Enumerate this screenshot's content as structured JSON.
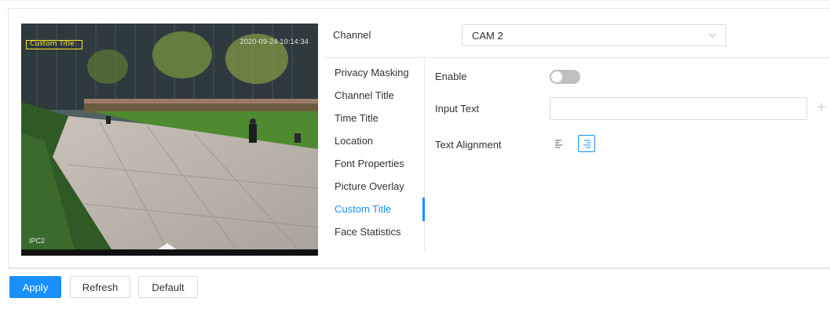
{
  "preview": {
    "osd_title": "Custom Title",
    "osd_time": "2020-09-24 10:14:34",
    "osd_channel": "IPC2"
  },
  "channel": {
    "label": "Channel",
    "value": "CAM 2"
  },
  "menu": {
    "items": [
      {
        "label": "Privacy Masking",
        "active": false
      },
      {
        "label": "Channel Title",
        "active": false
      },
      {
        "label": "Time Title",
        "active": false
      },
      {
        "label": "Location",
        "active": false
      },
      {
        "label": "Font Properties",
        "active": false
      },
      {
        "label": "Picture Overlay",
        "active": false
      },
      {
        "label": "Custom Title",
        "active": true
      },
      {
        "label": "Face Statistics",
        "active": false
      }
    ]
  },
  "settings": {
    "enable_label": "Enable",
    "enable_on": false,
    "input_text_label": "Input Text",
    "input_text_value": "",
    "text_alignment_label": "Text Alignment",
    "text_alignment_selected": "right"
  },
  "buttons": {
    "apply": "Apply",
    "refresh": "Refresh",
    "default": "Default"
  },
  "colors": {
    "accent": "#1890ff",
    "osd_yellow": "#f5e52a",
    "toggle_off": "#bfbfbf"
  },
  "icons": {
    "channel_select": "chevron-down-icon",
    "add_text": "plus-icon",
    "align_left": "align-left-icon",
    "align_right": "align-right-icon"
  }
}
